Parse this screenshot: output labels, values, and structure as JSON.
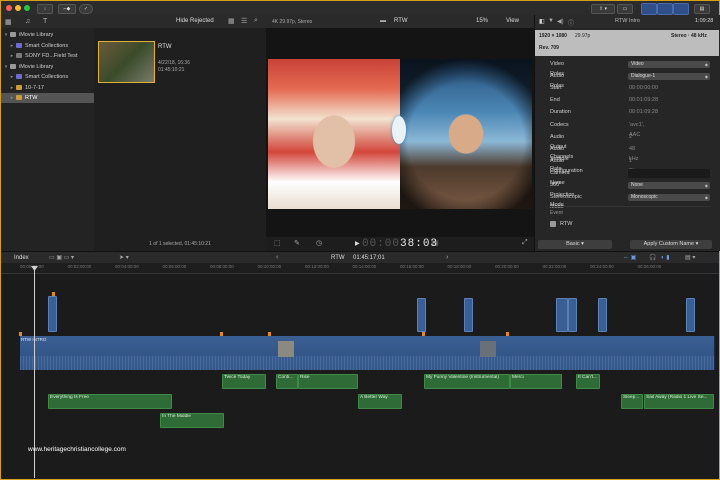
{
  "toolbar": {
    "import_label": "↓",
    "keyword_label": "⌐◆",
    "check_label": "✓"
  },
  "sidebar": {
    "items": [
      {
        "label": "iMovie Library",
        "depth": 0
      },
      {
        "label": "Smart Collections",
        "depth": 1
      },
      {
        "label": "SONY FD...Field Test",
        "depth": 1
      },
      {
        "label": "iMovie Library",
        "depth": 0
      },
      {
        "label": "Smart Collections",
        "depth": 1
      },
      {
        "label": "10-7-17",
        "depth": 1
      },
      {
        "label": "RTW",
        "depth": 1,
        "selected": true
      }
    ]
  },
  "browser": {
    "filter": "Hide Rejected",
    "clip": {
      "name": "RTW",
      "date": "4/22/18, 16:36",
      "duration": "01:45:10:21"
    },
    "status": "1 of 1 selected, 01:45:10:21"
  },
  "viewer": {
    "format": "4K 29.97p, Stereo",
    "title": "RTW",
    "zoom": "15%",
    "view_label": "View",
    "timecode_dim": "00:00",
    "timecode": "38:03"
  },
  "inspector": {
    "title": "RTW Intro",
    "duration": "1:09:28",
    "resolution": "1920 × 1080",
    "fps": "29.97p",
    "audio": "Stereo · 48 kHz",
    "rev": "Rev. 709",
    "rows": [
      {
        "label": "Video Roles",
        "value": "Video",
        "select": true
      },
      {
        "label": "Audio Roles",
        "value": "Dialogue-1",
        "select": true
      },
      {
        "label": "Start",
        "value": "00:00:00:00"
      },
      {
        "label": "End",
        "value": "00:01:09:28"
      },
      {
        "label": "Duration",
        "value": "00:01:09:28"
      },
      {
        "label": "Codecs",
        "value": "'avc1', AAC"
      },
      {
        "label": "Audio Output Channels",
        "value": "2"
      },
      {
        "label": "Audio Sample Rate",
        "value": "48 kHz"
      },
      {
        "label": "Audio Configuration",
        "value": "1 Stereo"
      },
      {
        "label": "Camera Name",
        "value": ""
      },
      {
        "label": "360° Projection Mode",
        "value": "None",
        "select": true
      },
      {
        "label": "Stereoscopic Mode",
        "value": "Monoscopic",
        "select": true
      }
    ],
    "event_label": "Event",
    "event_value": "RTW",
    "basic_label": "Basic",
    "apply_label": "Apply Custom Name"
  },
  "timeline": {
    "index_label": "Index",
    "project": "RTW",
    "position": "01:45:17;01",
    "ticks": [
      "00:00:00:00",
      "00:02:00:00",
      "00:04:00:00",
      "00:06:00:00",
      "00:08:00:00",
      "00:10:00:00",
      "00:12:00:00",
      "00:14:00:00",
      "00:16:00:00",
      "00:18:00:00",
      "00:20:00:00",
      "00:22:00:00",
      "00:24:00:00",
      "00:26:00:00"
    ],
    "primary_label": "RTW INTRO",
    "audio_clips": [
      "Everything Is Free",
      "In The Middle",
      "Twice Today",
      "Conti...",
      "Rise",
      "A Better Way",
      "My Funny Valentine (Instrumental)",
      "Merci",
      "It Can't...",
      "Sleep...",
      "Sail Away (Radio 1 Live Se..."
    ]
  },
  "watermark": "www.heritagechristiancollege.com",
  "colors": {
    "accent": "#d4a017",
    "clip_blue": "#3a5f94",
    "audio_green": "#2e6b36"
  }
}
